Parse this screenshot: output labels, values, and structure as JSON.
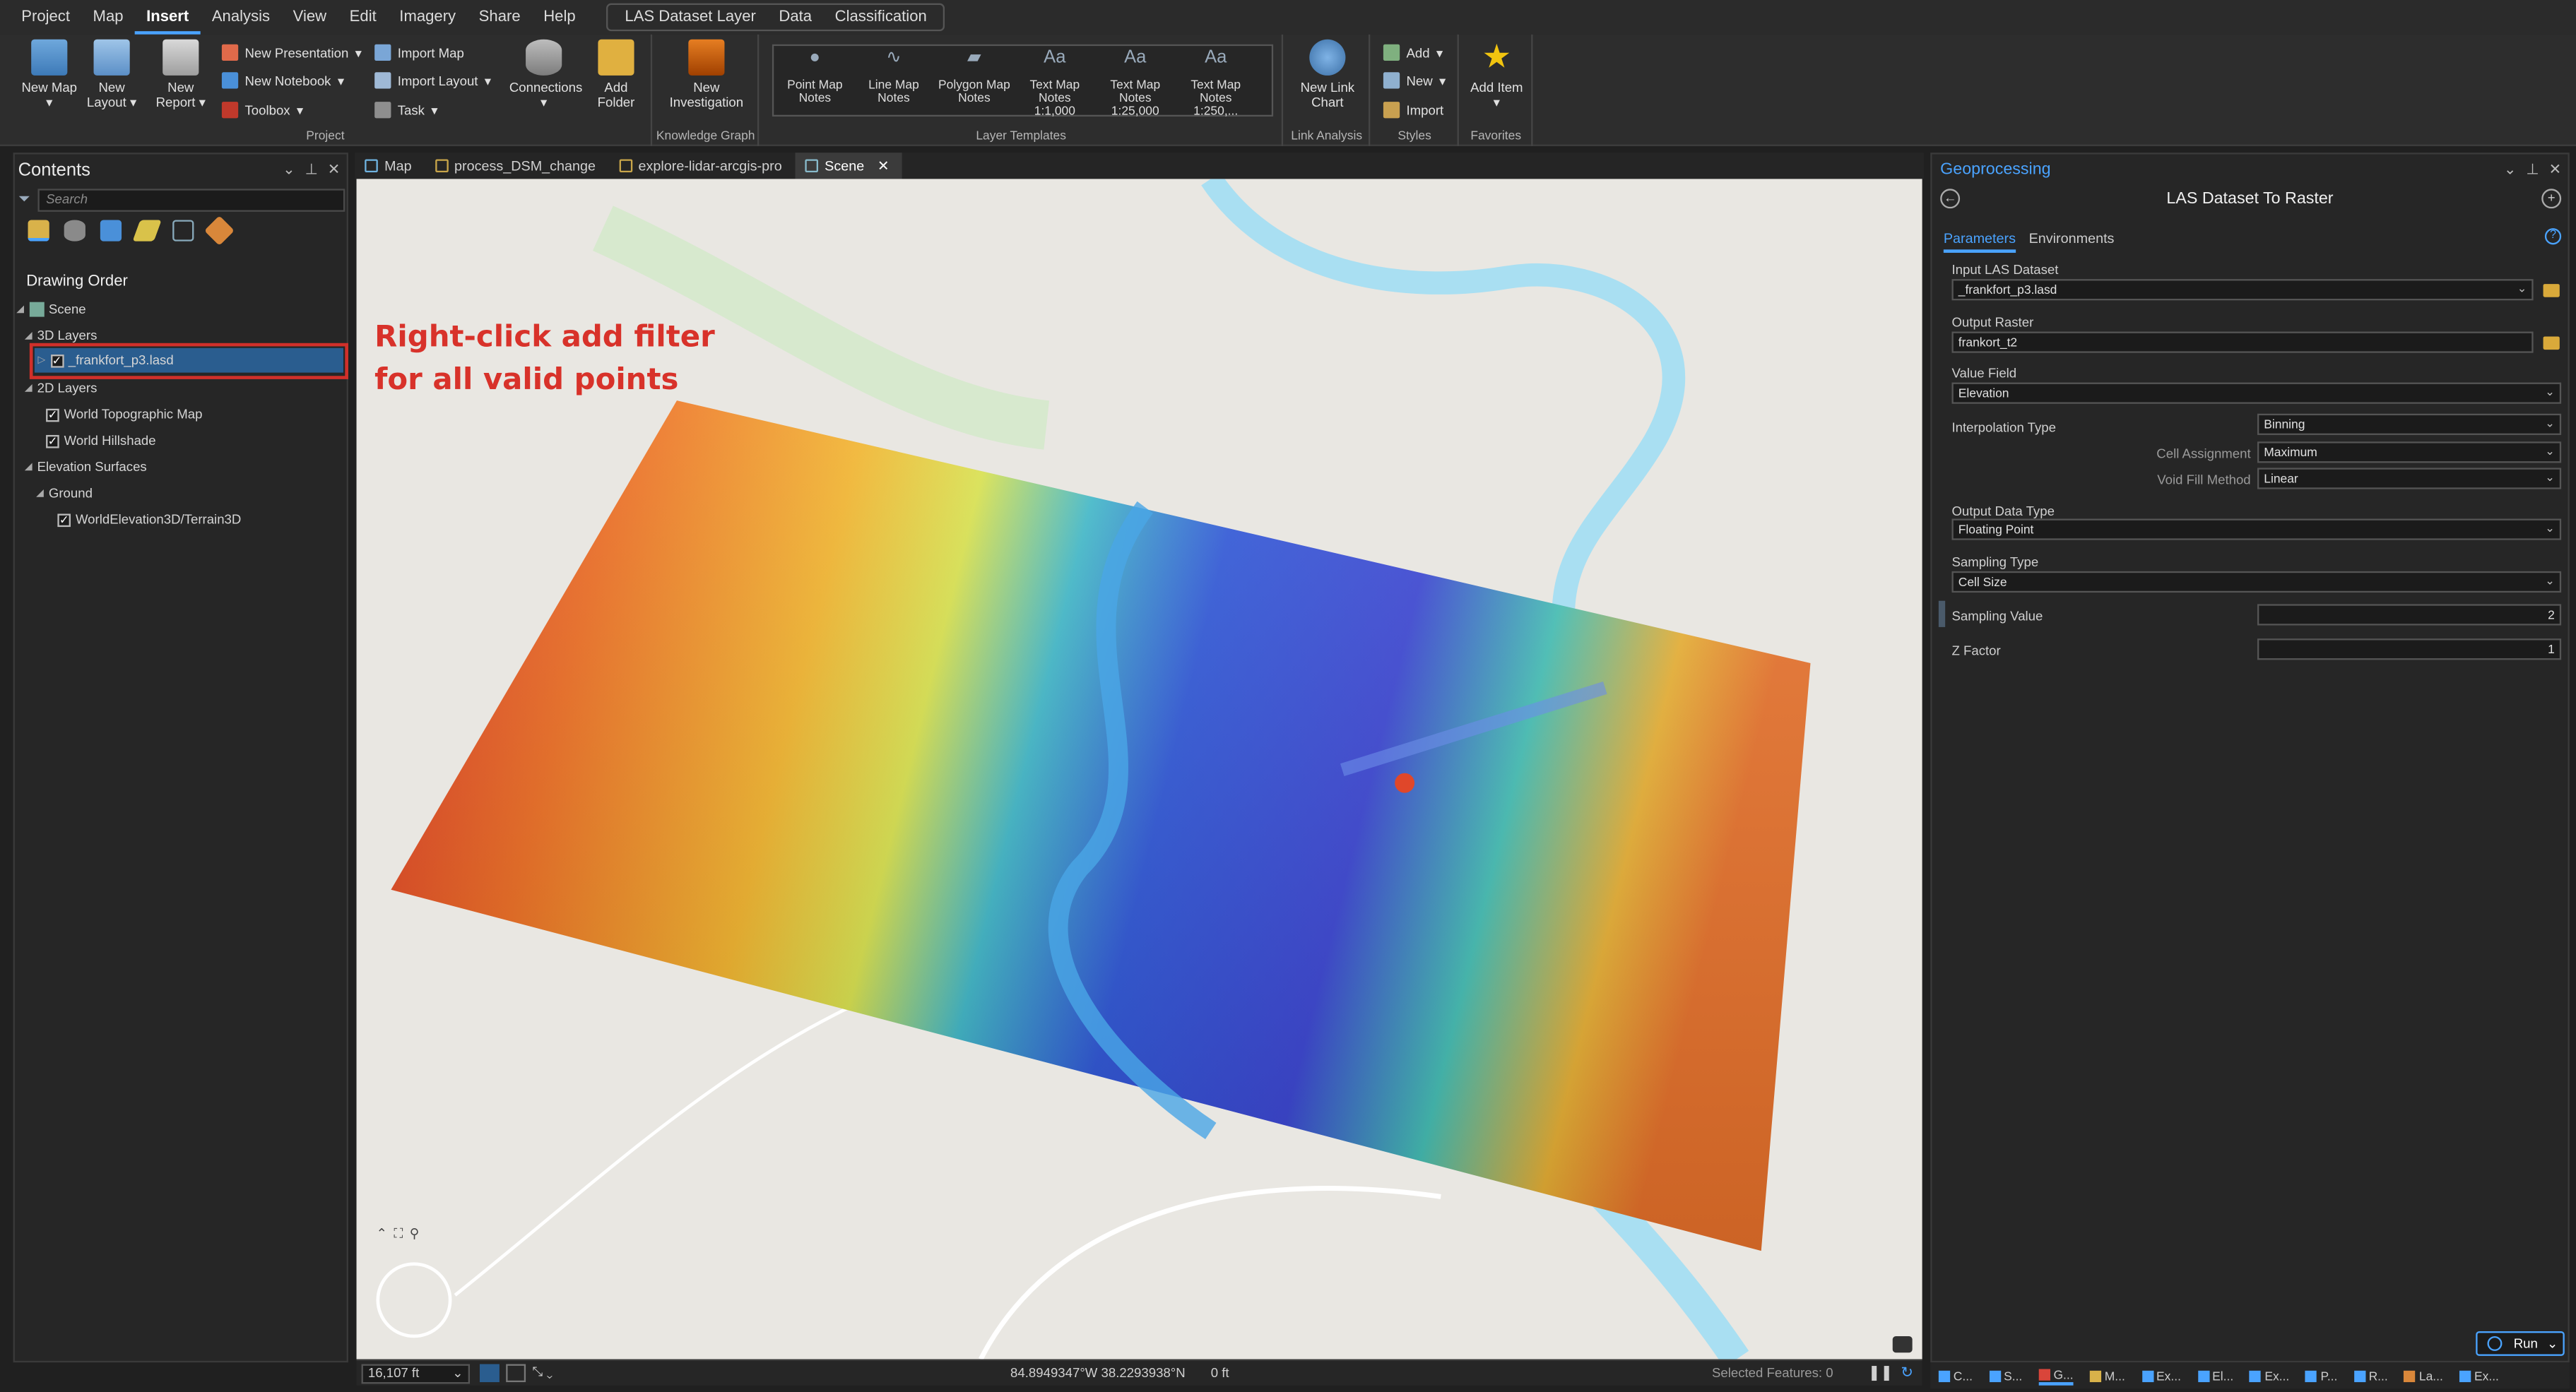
{
  "menubar": {
    "items": [
      "Project",
      "Map",
      "Insert",
      "Analysis",
      "View",
      "Edit",
      "Imagery",
      "Share",
      "Help"
    ],
    "active_index": 2,
    "context_items": [
      "LAS Dataset Layer",
      "Data",
      "Classification"
    ]
  },
  "ribbon": {
    "project": {
      "label": "Project",
      "new_map": "New Map",
      "new_layout": "New Layout",
      "new_report": "New Report",
      "new_presentation": "New Presentation",
      "new_notebook": "New Notebook",
      "toolbox": "Toolbox",
      "import_map": "Import Map",
      "import_layout": "Import Layout",
      "task": "Task",
      "connections": "Connections",
      "add_folder": "Add Folder"
    },
    "knowledge_graph": {
      "label": "Knowledge Graph",
      "new_investigation": "New Investigation"
    },
    "layer_templates": {
      "label": "Layer Templates",
      "items": [
        "Point Map Notes",
        "Line Map Notes",
        "Polygon Map Notes",
        "Text Map Notes 1:1,000",
        "Text Map Notes 1:25,000",
        "Text Map Notes 1:250,..."
      ]
    },
    "link_analysis": {
      "label": "Link Analysis",
      "new_link_chart": "New Link Chart"
    },
    "styles": {
      "label": "Styles",
      "add": "Add",
      "new": "New",
      "import": "Import"
    },
    "favorites": {
      "label": "Favorites",
      "add_item": "Add Item"
    }
  },
  "contents": {
    "title": "Contents",
    "search_placeholder": "Search",
    "drawing_order": "Drawing Order",
    "tree": {
      "scene": "Scene",
      "layers_3d": "3D Layers",
      "lasd": "_frankfort_p3.lasd",
      "layers_2d": "2D Layers",
      "topo": "World Topographic Map",
      "hillshade": "World Hillshade",
      "elevation_surfaces": "Elevation Surfaces",
      "ground": "Ground",
      "terrain": "WorldElevation3D/Terrain3D"
    }
  },
  "view_tabs": [
    "Map",
    "process_DSM_change",
    "explore-lidar-arcgis-pro",
    "Scene"
  ],
  "active_view_tab": "Scene",
  "annotation": {
    "line1": "Right-click add filter",
    "line2": "for all valid points"
  },
  "statusbar": {
    "scale": "16,107 ft",
    "coordinates": "84.8949347°W 38.2293938°N",
    "z": "0 ft",
    "selected_features": "Selected Features: 0"
  },
  "geoprocessing": {
    "title": "Geoprocessing",
    "tool": "LAS Dataset To Raster",
    "tabs": [
      "Parameters",
      "Environments"
    ],
    "input_las_label": "Input LAS Dataset",
    "input_las_value": "_frankfort_p3.lasd",
    "output_raster_label": "Output Raster",
    "output_raster_value": "frankort_t2",
    "value_field_label": "Value Field",
    "value_field_value": "Elevation",
    "interp_label": "Interpolation Type",
    "interp_value": "Binning",
    "cell_assign_label": "Cell Assignment",
    "cell_assign_value": "Maximum",
    "void_fill_label": "Void Fill Method",
    "void_fill_value": "Linear",
    "output_dtype_label": "Output Data Type",
    "output_dtype_value": "Floating Point",
    "sampling_type_label": "Sampling Type",
    "sampling_type_value": "Cell Size",
    "sampling_value_label": "Sampling Value",
    "sampling_value_value": "2",
    "z_factor_label": "Z Factor",
    "z_factor_value": "1",
    "run": "Run"
  },
  "bottom_tabs": [
    "C...",
    "S...",
    "G...",
    "M...",
    "Ex...",
    "El...",
    "Ex...",
    "P...",
    "R...",
    "La...",
    "Ex..."
  ],
  "colors": {
    "accent": "#4aa3ff",
    "annotation": "#d8322a",
    "selection": "#2a5d8f"
  }
}
